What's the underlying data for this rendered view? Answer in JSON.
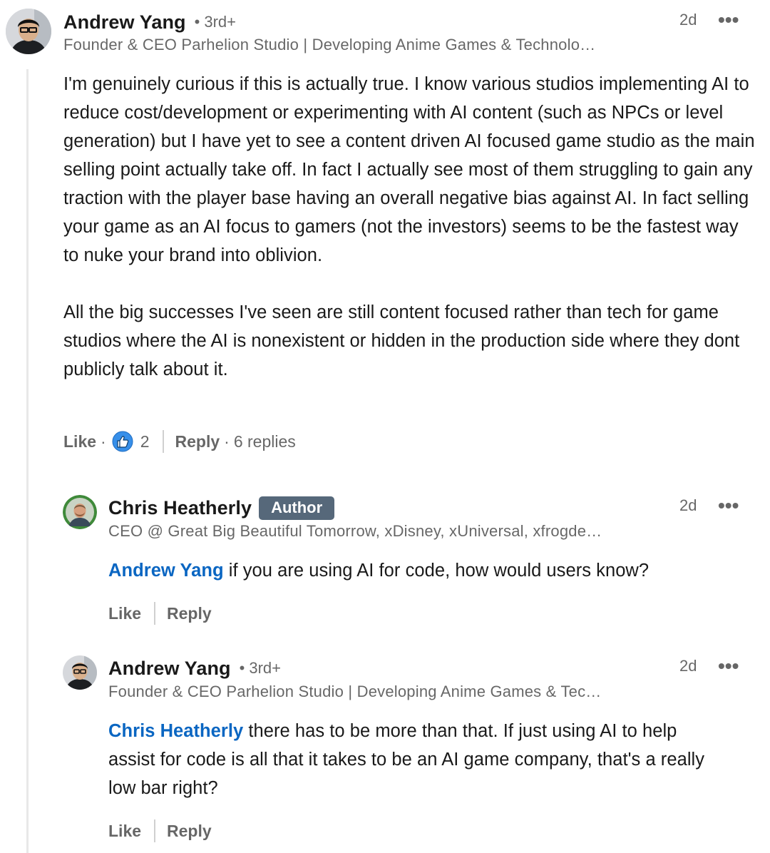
{
  "colors": {
    "mention": "#0a66c2",
    "author_badge": "#56687a",
    "thread_line": "#e8e8e8",
    "like_reaction": "#378fe9"
  },
  "comment1": {
    "name": "Andrew Yang",
    "degree_dot": "•",
    "degree": "3rd+",
    "headline": "Founder & CEO Parhelion Studio | Developing Anime Games & Technolo…",
    "time": "2d",
    "more_icon": "•••",
    "paragraphs": [
      "I'm genuinely curious if this is actually true. I know various studios implementing AI to reduce cost/development or experimenting with AI content (such as NPCs or level generation) but I have yet to see a content driven AI focused game studio as the main selling point actually take off. In fact I actually see most of them struggling to gain any traction with the player base having an overall negative bias against AI. In fact selling your game as an AI focus to gamers (not the investors) seems to be the fastest way to nuke your brand into oblivion.",
      "All the big successes I've seen are still content focused rather than tech for game studios where the AI is nonexistent or hidden in the production side where they dont publicly talk about it."
    ],
    "like_label": "Like",
    "sep_dot": "·",
    "reaction_count": "2",
    "reply_label": "Reply",
    "replies_count": "6 replies"
  },
  "reply1": {
    "name": "Chris Heatherly",
    "badge": "Author",
    "headline": "CEO @ Great Big Beautiful Tomorrow, xDisney, xUniversal, xfrogde…",
    "time": "2d",
    "more_icon": "•••",
    "mention": "Andrew Yang",
    "text": " if you are using AI for code, how would users know?",
    "like_label": "Like",
    "reply_label": "Reply"
  },
  "reply2": {
    "name": "Andrew Yang",
    "degree_dot": "•",
    "degree": "3rd+",
    "headline": "Founder & CEO Parhelion Studio | Developing Anime Games & Tec…",
    "time": "2d",
    "more_icon": "•••",
    "mention": "Chris Heatherly",
    "text": " there has to be more than that. If just using AI to help assist for code is all that it takes to be an AI game company, that's a really low bar right?",
    "like_label": "Like",
    "reply_label": "Reply"
  }
}
